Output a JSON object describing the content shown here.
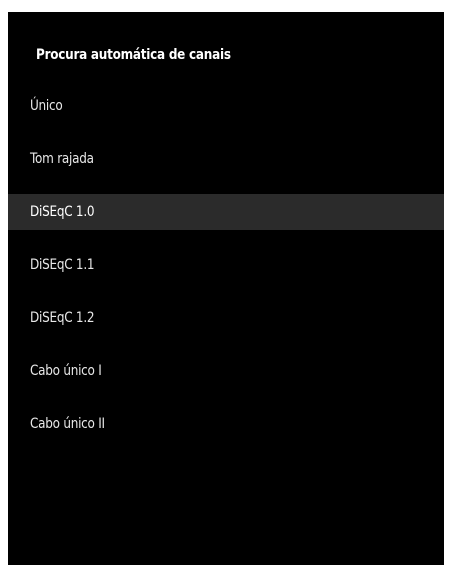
{
  "header": {
    "title": "Procura automática de canais"
  },
  "menu": {
    "selected_index": 2,
    "items": [
      {
        "label": "Único"
      },
      {
        "label": "Tom rajada"
      },
      {
        "label": "DiSEqC 1.0"
      },
      {
        "label": "DiSEqC 1.1"
      },
      {
        "label": "DiSEqC 1.2"
      },
      {
        "label": "Cabo único I"
      },
      {
        "label": "Cabo único II"
      }
    ]
  },
  "colors": {
    "background": "#000000",
    "highlight": "#2b2b2b",
    "text": "#ffffff"
  }
}
